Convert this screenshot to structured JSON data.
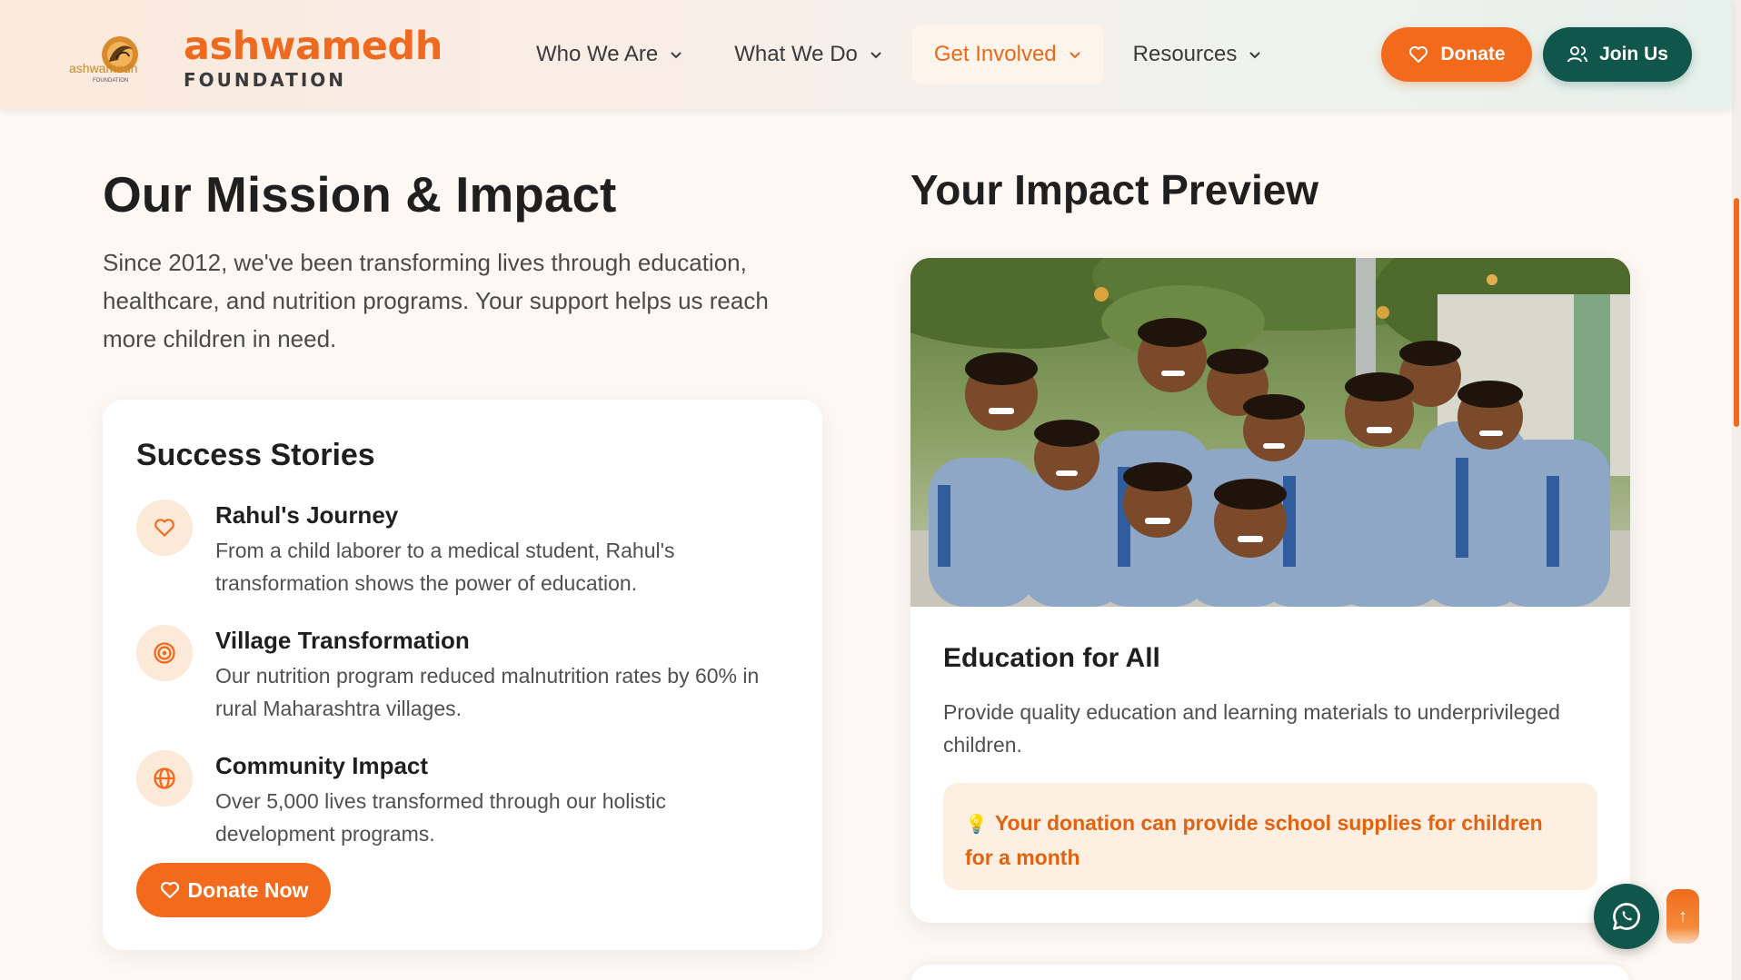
{
  "header": {
    "brand_name": "ashwamedh",
    "brand_sub": "FOUNDATION",
    "logo_text_top": "ashwamedh",
    "logo_text_bottom": "FOUNDATION",
    "nav": [
      {
        "label": "Who We Are",
        "active": false
      },
      {
        "label": "What We Do",
        "active": false
      },
      {
        "label": "Get Involved",
        "active": true
      },
      {
        "label": "Resources",
        "active": false
      }
    ],
    "donate_label": "Donate",
    "join_label": "Join Us"
  },
  "mission": {
    "title": "Our Mission & Impact",
    "text": "Since 2012, we've been transforming lives through education, healthcare, and nutrition programs. Your support helps us reach more children in need."
  },
  "stories": {
    "title": "Success Stories",
    "items": [
      {
        "icon": "heart-icon",
        "title": "Rahul's Journey",
        "desc": "From a child laborer to a medical student, Rahul's transformation shows the power of education."
      },
      {
        "icon": "target-icon",
        "title": "Village Transformation",
        "desc": "Our nutrition program reduced malnutrition rates by 60% in rural Maharashtra villages."
      },
      {
        "icon": "globe-icon",
        "title": "Community Impact",
        "desc": "Over 5,000 lives transformed through our holistic development programs."
      }
    ],
    "cta_label": "Donate Now"
  },
  "preview": {
    "title": "Your Impact Preview",
    "program_title": "Education for All",
    "program_desc": "Provide quality education and learning materials to underprivileged children.",
    "impact_note": "Your donation can provide school supplies for children for a month",
    "bulb": "💡"
  },
  "floating": {
    "scroll_top_glyph": "↑"
  },
  "colors": {
    "accent": "#f26b1c",
    "primary_dark": "#11564b",
    "page_bg": "#fdf8f4"
  }
}
